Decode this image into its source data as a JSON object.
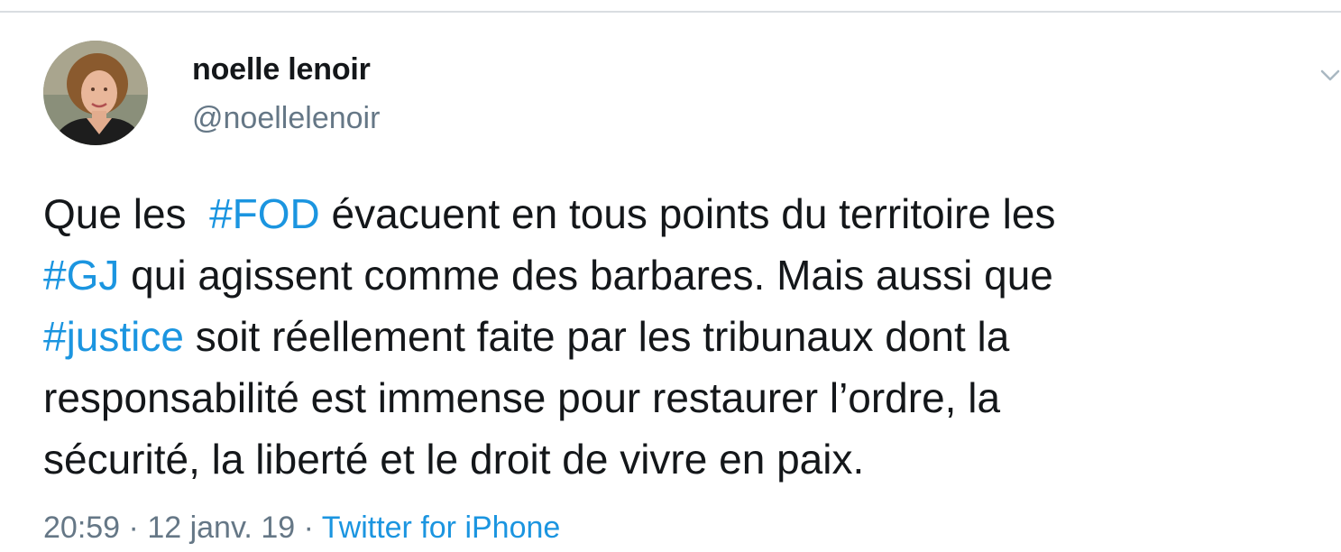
{
  "tweet": {
    "author": {
      "display_name": "noelle lenoir",
      "handle": "@noellelenoir"
    },
    "menu_icon": "chevron-down-icon",
    "body": {
      "line1": {
        "t1": "Que les  ",
        "h1": "#FOD",
        "t2": " évacuent en tous points du territoire les"
      },
      "line2": {
        "h1": "#GJ",
        "t1": " qui agissent comme des barbares. Mais aussi que"
      },
      "line3": {
        "h1": "#justice",
        "t1": " soit réellement faite par les tribunaux dont la"
      },
      "line4": {
        "t1": "responsabilité est immense pour restaurer l’ordre, la"
      },
      "line5": {
        "t1": "sécurité, la liberté et le droit de vivre en paix."
      }
    },
    "meta": {
      "time": "20:59",
      "separator1": " · ",
      "date": "12 janv. 19",
      "separator2": " · ",
      "source": "Twitter for iPhone"
    }
  },
  "colors": {
    "text": "#14171a",
    "secondary": "#657786",
    "link": "#1b95e0",
    "divider": "#d9dde1"
  }
}
